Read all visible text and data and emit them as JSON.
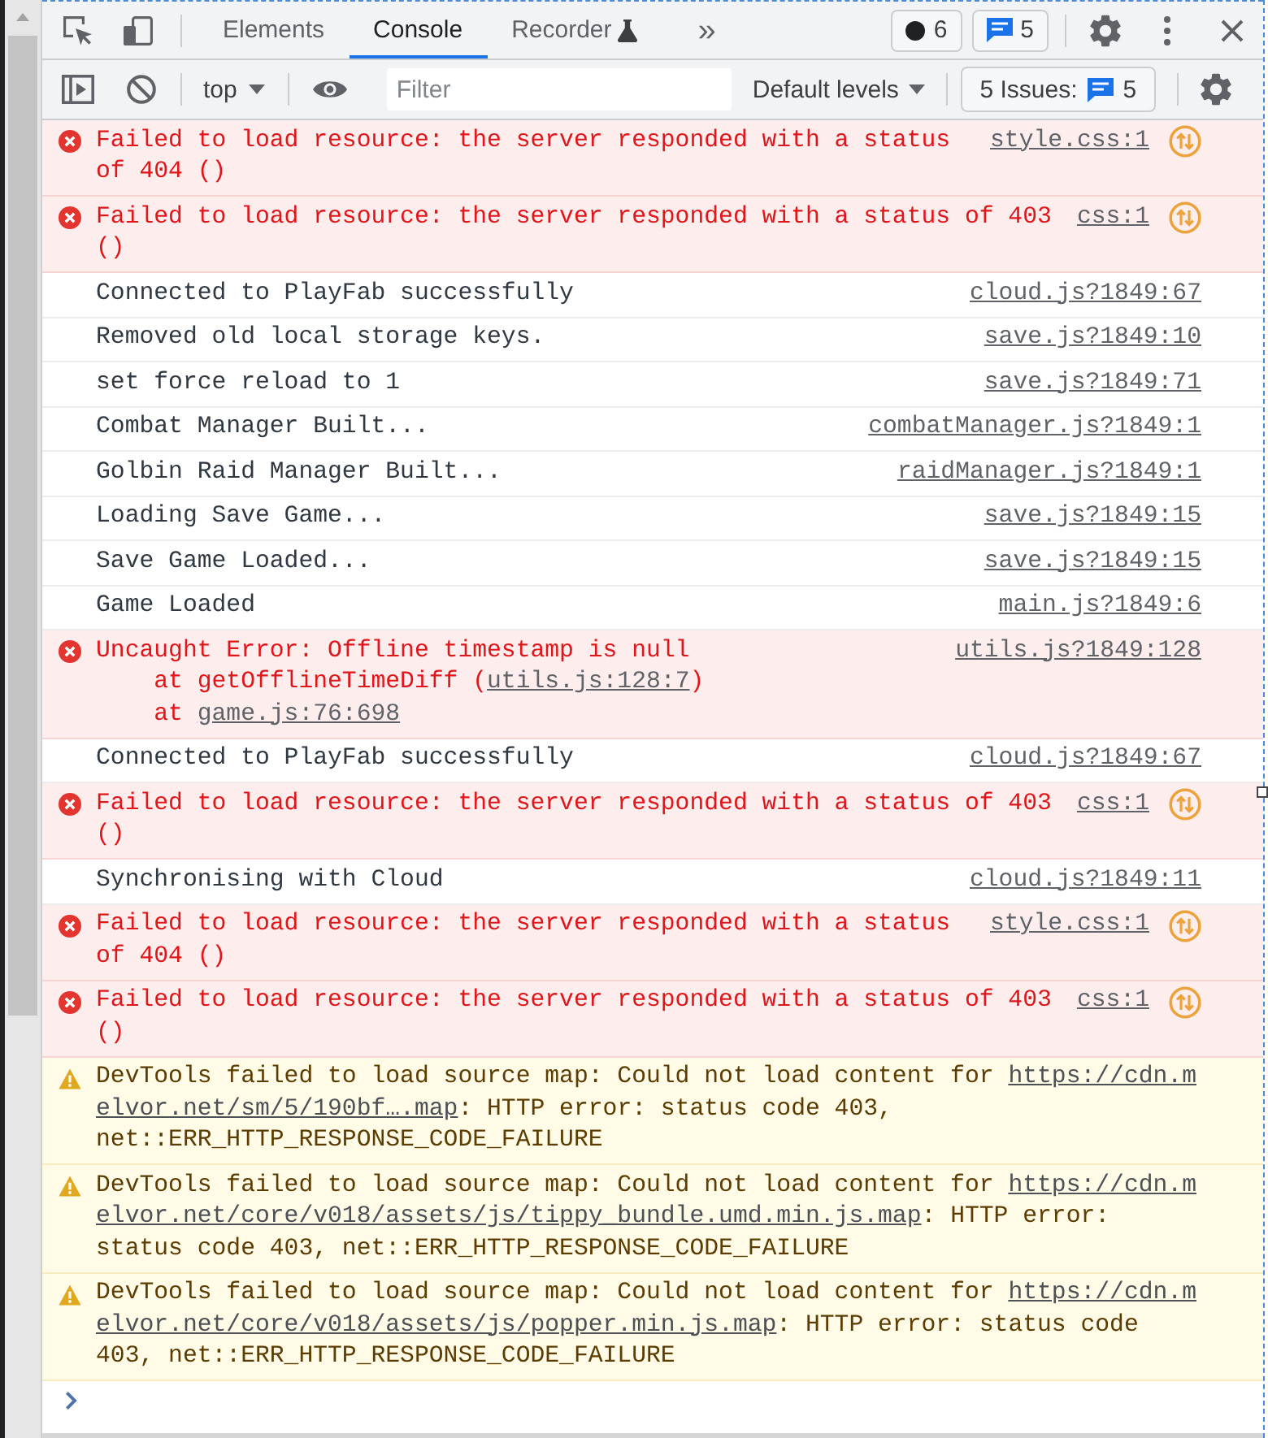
{
  "tab_bar": {
    "tabs": [
      {
        "label": "Elements",
        "selected": false,
        "experimental": false
      },
      {
        "label": "Console",
        "selected": true,
        "experimental": false
      },
      {
        "label": "Recorder",
        "selected": false,
        "experimental": true
      }
    ],
    "more_tabs": "»",
    "error_count": "6",
    "message_count": "5"
  },
  "console_toolbar": {
    "context": "top",
    "filter": {
      "placeholder": "Filter"
    },
    "levels": "Default levels",
    "issues": {
      "label": "5 Issues:",
      "count": "5"
    }
  },
  "messages": [
    {
      "kind": "error",
      "text": "Failed to load resource: the server responded with a status of 404 ()",
      "source": "style.css:1",
      "network_request": true
    },
    {
      "kind": "error",
      "text": "Failed to load resource: the server responded with a status of 403 ()",
      "source": "css:1",
      "network_request": true
    },
    {
      "kind": "log",
      "text": "Connected to PlayFab successfully",
      "source": "cloud.js?1849:67",
      "network_request": false
    },
    {
      "kind": "log",
      "text": "Removed old local storage keys.",
      "source": "save.js?1849:10",
      "network_request": false
    },
    {
      "kind": "log",
      "text": "set force reload to 1",
      "source": "save.js?1849:71",
      "network_request": false
    },
    {
      "kind": "log",
      "text": "Combat Manager Built...",
      "source": "combatManager.js?1849:1",
      "network_request": false
    },
    {
      "kind": "log",
      "text": "Golbin Raid Manager Built...",
      "source": "raidManager.js?1849:1",
      "network_request": false
    },
    {
      "kind": "log",
      "text": "Loading Save Game...",
      "source": "save.js?1849:15",
      "network_request": false
    },
    {
      "kind": "log",
      "text": "Save Game Loaded...",
      "source": "save.js?1849:15",
      "network_request": false
    },
    {
      "kind": "log",
      "text": "Game Loaded",
      "source": "main.js?1849:6",
      "network_request": false
    },
    {
      "kind": "error",
      "text": "Uncaught Error: Offline timestamp is null",
      "stack": [
        {
          "before": "at getOfflineTimeDiff (",
          "link": "utils.js:128:7",
          "after": ")"
        },
        {
          "before": "at ",
          "link": "game.js:76:698"
        }
      ],
      "source": "utils.js?1849:128",
      "network_request": false
    },
    {
      "kind": "log",
      "text": "Connected to PlayFab successfully",
      "source": "cloud.js?1849:67",
      "network_request": false
    },
    {
      "kind": "error",
      "text": "Failed to load resource: the server responded with a status of 403 ()",
      "source": "css:1",
      "network_request": true
    },
    {
      "kind": "log",
      "text": "Synchronising with Cloud",
      "source": "cloud.js?1849:11",
      "network_request": false
    },
    {
      "kind": "error",
      "text": "Failed to load resource: the server responded with a status of 404 ()",
      "source": "style.css:1",
      "network_request": true
    },
    {
      "kind": "error",
      "text": "Failed to load resource: the server responded with a status of 403 ()",
      "source": "css:1",
      "network_request": true
    },
    {
      "kind": "warning",
      "text": "DevTools failed to load source map: Could not load content for ",
      "link_lines": [
        "https://cdn.m",
        "elvor.net/sm/5/190bf….map"
      ],
      "after": ": HTTP error: status code 403, net::ERR_HTTP_RESPONSE_CODE_FAILURE"
    },
    {
      "kind": "warning",
      "text": "DevTools failed to load source map: Could not load content for ",
      "link_lines": [
        "https://cdn.m",
        "elvor.net/core/v018/assets/js/tippy_bundle.umd.min.js.map"
      ],
      "after": ": HTTP error: status code 403, net::ERR_HTTP_RESPONSE_CODE_FAILURE"
    },
    {
      "kind": "warning",
      "text": "DevTools failed to load source map: Could not load content for ",
      "link_lines": [
        "https://cdn.m",
        "elvor.net/core/v018/assets/js/popper.min.js.map"
      ],
      "after": ": HTTP error: status code 403, net::ERR_HTTP_RESPONSE_CODE_FAILURE"
    }
  ]
}
